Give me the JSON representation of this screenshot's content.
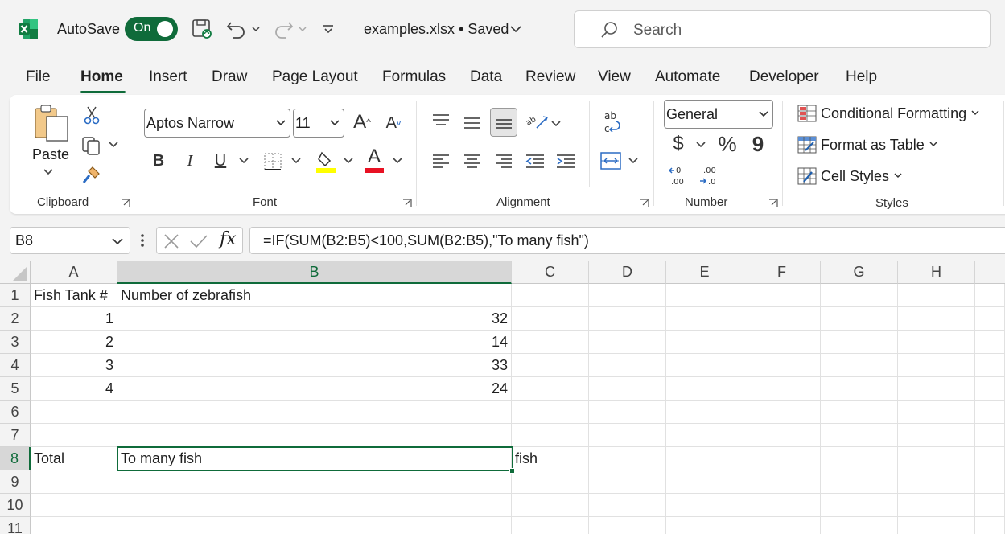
{
  "titlebar": {
    "autosave_label": "AutoSave",
    "autosave_state": "On",
    "filename": "examples.xlsx • Saved",
    "search_placeholder": "Search"
  },
  "menu": {
    "tabs": [
      "File",
      "Home",
      "Insert",
      "Draw",
      "Page Layout",
      "Formulas",
      "Data",
      "Review",
      "View",
      "Automate",
      "Developer",
      "Help"
    ],
    "active": "Home"
  },
  "ribbon": {
    "clipboard": {
      "label": "Clipboard",
      "paste": "Paste"
    },
    "font": {
      "label": "Font",
      "family": "Aptos Narrow",
      "size": "11",
      "bold": "B",
      "italic": "I",
      "underline": "U",
      "grow": "A",
      "shrink": "A",
      "font_color_glyph": "A",
      "font_color": "#e81123",
      "highlight_color": "#ffff00"
    },
    "alignment": {
      "label": "Alignment"
    },
    "number": {
      "label": "Number",
      "format": "General",
      "currency": "$",
      "percent": "%",
      "comma": "9"
    },
    "styles": {
      "label": "Styles",
      "conditional": "Conditional Formatting",
      "format_table": "Format as Table",
      "cell_styles": "Cell Styles"
    }
  },
  "formula_bar": {
    "name_box": "B8",
    "formula": "=IF(SUM(B2:B5)<100,SUM(B2:B5),\"To many fish\")"
  },
  "sheet": {
    "columns": [
      "A",
      "B",
      "C",
      "D",
      "E",
      "F",
      "G",
      "H"
    ],
    "rows": [
      "1",
      "2",
      "3",
      "4",
      "5",
      "6",
      "7",
      "8",
      "9",
      "10",
      "11"
    ],
    "selected_column": "B",
    "selected_row": "8",
    "cells": {
      "A1": "Fish Tank #",
      "B1": "Number of zebrafish",
      "A2": "1",
      "B2": "32",
      "A3": "2",
      "B3": "14",
      "A4": "3",
      "B4": "33",
      "A5": "4",
      "B5": "24",
      "A8": "Total",
      "B8": "To many fish",
      "C8": "fish"
    }
  },
  "colors": {
    "accent": "#0f6b3a",
    "excel_green": "#107c41"
  }
}
